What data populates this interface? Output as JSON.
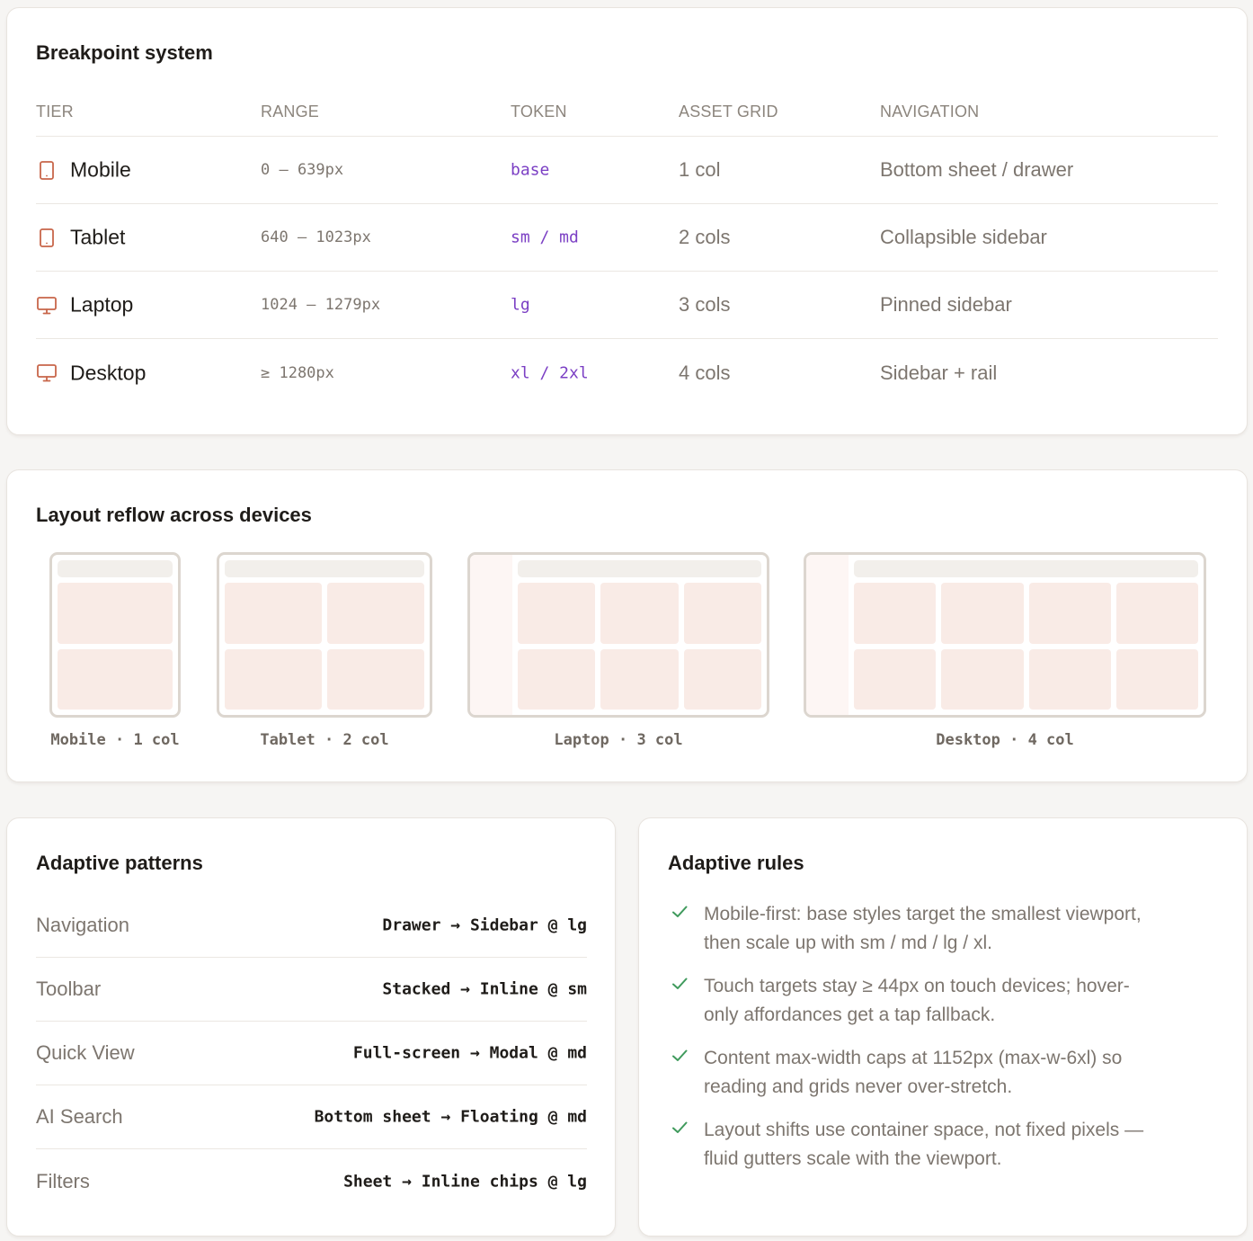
{
  "breakpoints": {
    "title": "Breakpoint system",
    "headers": [
      "TIER",
      "RANGE",
      "TOKEN",
      "ASSET GRID",
      "NAVIGATION"
    ],
    "rows": [
      {
        "icon": "tablet-icon",
        "tier": "Mobile",
        "range": "0 – 639px",
        "token": "base",
        "grid": "1 col",
        "nav": "Bottom sheet / drawer"
      },
      {
        "icon": "tablet-icon",
        "tier": "Tablet",
        "range": "640 – 1023px",
        "token": "sm / md",
        "grid": "2 cols",
        "nav": "Collapsible sidebar"
      },
      {
        "icon": "monitor-icon",
        "tier": "Laptop",
        "range": "1024 – 1279px",
        "token": "lg",
        "grid": "3 cols",
        "nav": "Pinned sidebar"
      },
      {
        "icon": "monitor-icon",
        "tier": "Desktop",
        "range": "≥ 1280px",
        "token": "xl / 2xl",
        "grid": "4 cols",
        "nav": "Sidebar + rail"
      }
    ]
  },
  "reflow": {
    "title": "Layout reflow across devices",
    "devices": [
      {
        "label": "Mobile · 1 col",
        "columns": 1,
        "rows": 2,
        "rail": false
      },
      {
        "label": "Tablet · 2 col",
        "columns": 2,
        "rows": 2,
        "rail": false
      },
      {
        "label": "Laptop · 3 col",
        "columns": 3,
        "rows": 2,
        "rail": true
      },
      {
        "label": "Desktop · 4 col",
        "columns": 4,
        "rows": 2,
        "rail": true
      }
    ]
  },
  "patterns": {
    "title": "Adaptive patterns",
    "items": [
      {
        "label": "Navigation",
        "value": "Drawer → Sidebar @ lg"
      },
      {
        "label": "Toolbar",
        "value": "Stacked → Inline @ sm"
      },
      {
        "label": "Quick View",
        "value": "Full-screen → Modal @ md"
      },
      {
        "label": "AI Search",
        "value": "Bottom sheet → Floating @ md"
      },
      {
        "label": "Filters",
        "value": "Sheet → Inline chips @ lg"
      }
    ]
  },
  "rules": {
    "title": "Adaptive rules",
    "items": [
      {
        "line1": "Mobile-first: base styles target the smallest viewport,",
        "line2": "then scale up with sm / md / lg / xl."
      },
      {
        "line1": "Touch targets stay ≥ 44px on touch devices; hover-",
        "line2": "only affordances get a tap fallback."
      },
      {
        "line1": "Content max-width caps at 1152px (max-w-6xl) so",
        "line2": "reading and grids never over-stretch."
      },
      {
        "line1": "Layout shifts use container space, not fixed pixels —",
        "line2": "fluid gutters scale with the viewport."
      }
    ]
  },
  "colors": {
    "accent_icon": "#c8664a",
    "token": "#7b3fc4",
    "check": "#3f9a5c",
    "tile": "#f9ebe6"
  }
}
